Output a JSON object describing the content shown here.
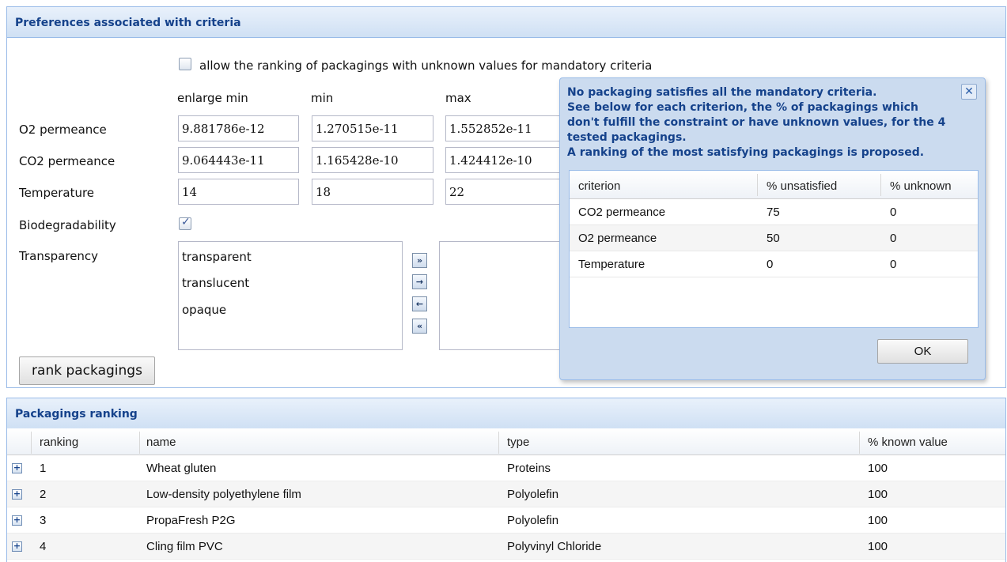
{
  "preferences_panel": {
    "title": "Preferences associated with criteria",
    "allow_unknown_label": "allow the ranking of packagings with unknown values for mandatory criteria",
    "allow_unknown_checked": false,
    "columns": {
      "enlarge_min": "enlarge min",
      "min": "min",
      "max": "max"
    },
    "criteria": [
      {
        "label": "O2 permeance",
        "enlarge_min": "9.881786e-12",
        "min": "1.270515e-11",
        "max": "1.552852e-11"
      },
      {
        "label": "CO2 permeance",
        "enlarge_min": "9.064443e-11",
        "min": "1.165428e-10",
        "max": "1.424412e-10"
      },
      {
        "label": "Temperature",
        "enlarge_min": "14",
        "min": "18",
        "max": "22"
      }
    ],
    "biodegradability": {
      "label": "Biodegradability",
      "checked": true
    },
    "transparency": {
      "label": "Transparency",
      "available": [
        "transparent",
        "translucent",
        "opaque"
      ],
      "selected": []
    },
    "transfer_buttons": [
      "add-all-icon",
      "add-icon",
      "remove-icon",
      "remove-all-icon"
    ],
    "rank_button": "rank packagings"
  },
  "dialog": {
    "lines": [
      "No packaging satisfies all the mandatory criteria.",
      "See below for each criterion, the % of packagings which",
      "don't fulfill the constraint or have unknown values, for the 4",
      "tested packagings.",
      "A ranking of the most satisfying packagings is proposed."
    ],
    "columns": [
      "criterion",
      "% unsatisfied",
      "% unknown"
    ],
    "rows": [
      [
        "CO2 permeance",
        "75",
        "0"
      ],
      [
        "O2 permeance",
        "50",
        "0"
      ],
      [
        "Temperature",
        "0",
        "0"
      ]
    ],
    "ok_label": "OK"
  },
  "ranking_panel": {
    "title": "Packagings ranking",
    "columns": [
      "ranking",
      "name",
      "type",
      "% known value"
    ],
    "rows": [
      [
        "1",
        "Wheat gluten",
        "Proteins",
        "100"
      ],
      [
        "2",
        "Low-density polyethylene film",
        "Polyolefin",
        "100"
      ],
      [
        "3",
        "PropaFresh P2G",
        "Polyolefin",
        "100"
      ],
      [
        "4",
        "Cling film PVC",
        "Polyvinyl Chloride",
        "100"
      ]
    ]
  },
  "colors": {
    "header_text": "#15428b",
    "border": "#99bbe8",
    "dialog_bg": "#cbdbef"
  }
}
